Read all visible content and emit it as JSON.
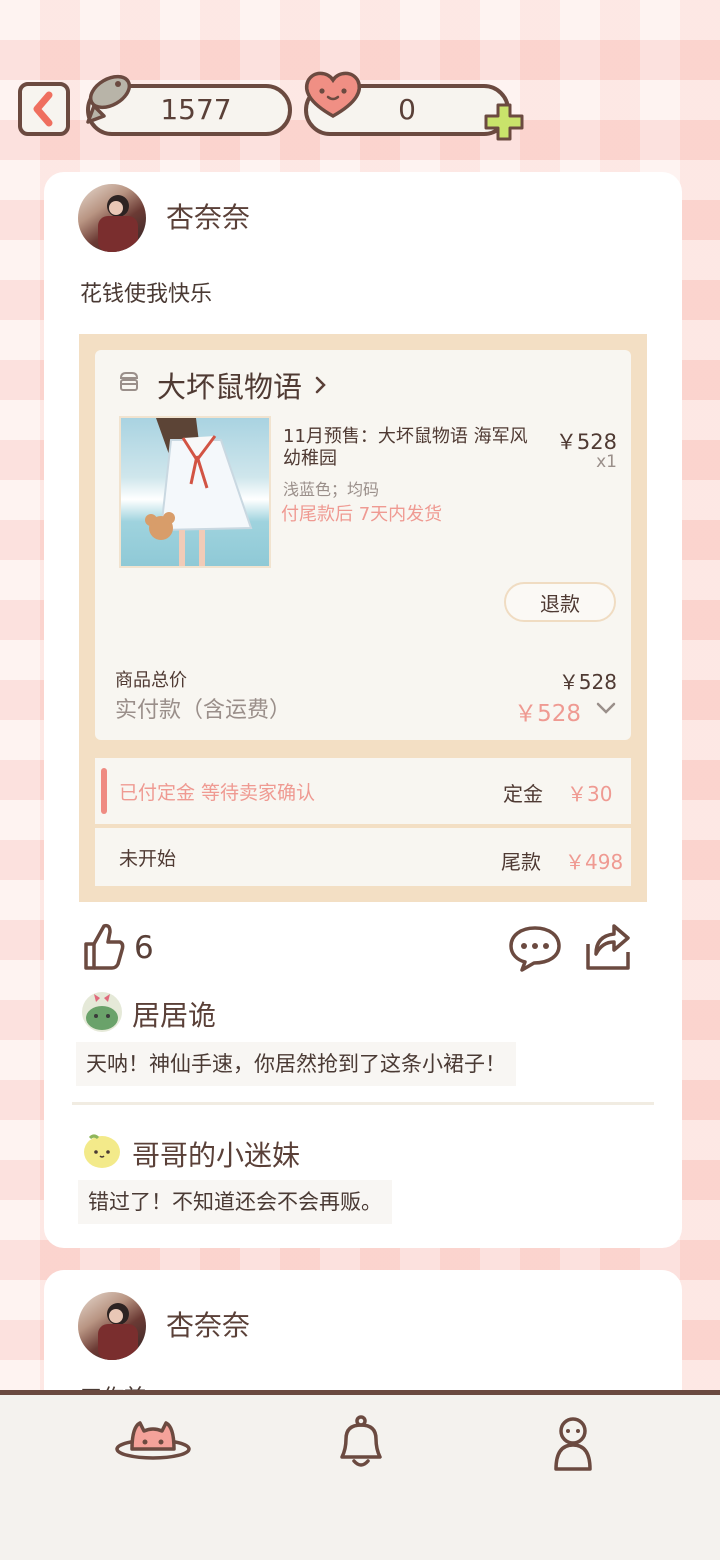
{
  "header": {
    "fish_count": "1577",
    "heart_count": "0"
  },
  "posts": [
    {
      "username": "杏奈奈",
      "text": "花钱使我快乐",
      "order": {
        "shop_name": "大坏鼠物语",
        "product_title_line1": "11月预售：大坏鼠物语 海军风",
        "product_title_line2": "幼稚园",
        "price": "￥528",
        "qty": "x1",
        "spec": "浅蓝色；均码",
        "shipping_note": "付尾款后 7天内发货",
        "refund_label": "退款",
        "total_label": "商品总价",
        "total_value": "￥528",
        "paid_label": "实付款（含运费）",
        "paid_value": "￥528",
        "deposit_status": "已付定金 等待卖家确认",
        "deposit_label": "定金",
        "deposit_value": "￥30",
        "balance_status": "未开始",
        "balance_label": "尾款",
        "balance_value": "￥498"
      },
      "likes": "6",
      "comments": [
        {
          "user": "居居诡",
          "text": "天呐！神仙手速，你居然抢到了这条小裙子！"
        },
        {
          "user": "哥哥的小迷妹",
          "text": "错过了！不知道还会不会再贩。"
        }
      ]
    },
    {
      "username": "杏奈奈",
      "text": "工作首..."
    }
  ],
  "colors": {
    "accent_pink": "#ef9a92",
    "outline_brown": "#6b4a40",
    "order_border": "#f3dfc4"
  },
  "icons": [
    "back-arrow-icon",
    "fish-icon",
    "heart-face-icon",
    "plus-icon",
    "shop-icon",
    "chevron-right-icon",
    "chevron-down-icon",
    "thumbs-up-icon",
    "comment-icon",
    "share-icon",
    "planet-cat-icon",
    "bell-icon",
    "person-icon"
  ]
}
